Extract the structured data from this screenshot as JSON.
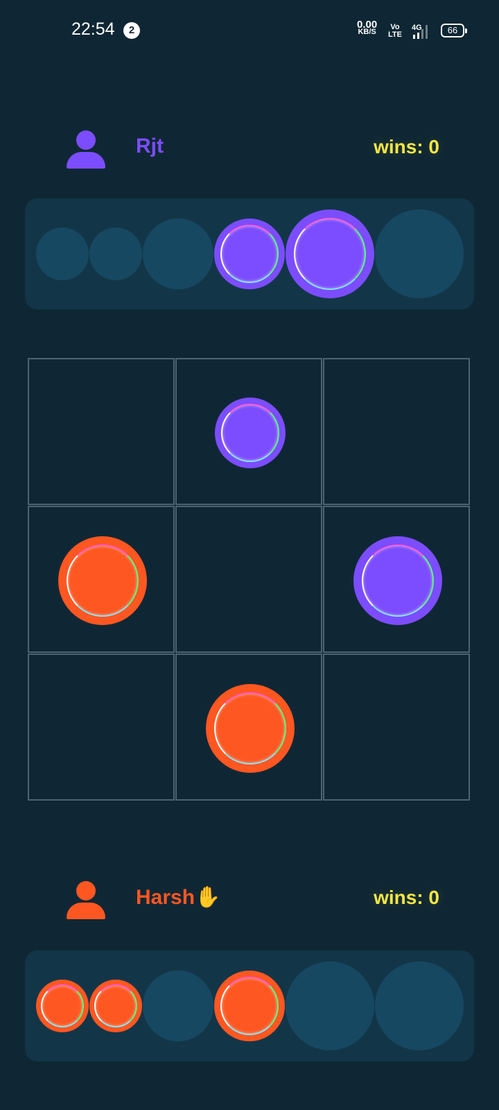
{
  "status_bar": {
    "time": "22:54",
    "notification_count": "2",
    "net_speed_value": "0.00",
    "net_speed_unit": "KB/S",
    "volte_top": "Vo",
    "volte_bottom": "LTE",
    "network_label": "4G",
    "battery_level": "66"
  },
  "colors": {
    "background": "#0f2734",
    "player1": "#7c4dff",
    "player2": "#ff5722",
    "wins_text": "#f5e642",
    "tray": "#123648",
    "empty_slot": "#174862"
  },
  "player_top": {
    "name": "Rjt",
    "wins_label": "wins: 0",
    "icon": "person-icon",
    "color": "#7c4dff",
    "tray": [
      "empty",
      "empty",
      "empty",
      "filled",
      "filled",
      "empty"
    ]
  },
  "player_bottom": {
    "name": "Harsh",
    "turn_marker": "✋",
    "wins_label": "wins: 0",
    "icon": "person-icon",
    "color": "#ff5722",
    "tray": [
      "filled",
      "filled",
      "empty",
      "filled",
      "empty",
      "empty"
    ]
  },
  "board": {
    "cells": [
      null,
      {
        "player": "Rjt",
        "size": "small"
      },
      null,
      {
        "player": "Harsh",
        "size": "large"
      },
      null,
      {
        "player": "Rjt",
        "size": "large"
      },
      null,
      {
        "player": "Harsh",
        "size": "large"
      },
      null
    ]
  }
}
